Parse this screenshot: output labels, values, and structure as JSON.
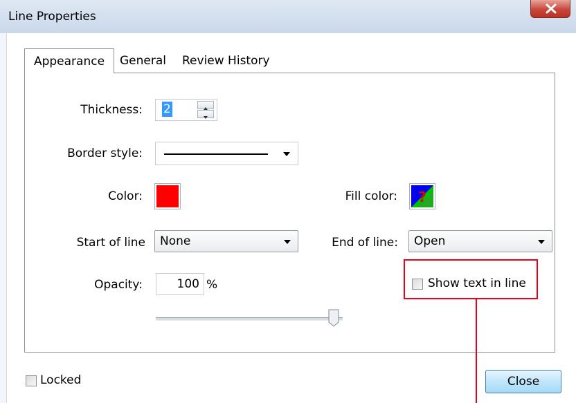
{
  "window": {
    "title": "Line Properties"
  },
  "tabs": [
    {
      "label": "Appearance",
      "active": true
    },
    {
      "label": "General",
      "active": false
    },
    {
      "label": "Review History",
      "active": false
    }
  ],
  "appearance": {
    "thickness": {
      "label": "Thickness:",
      "value": "2"
    },
    "border_style": {
      "label": "Border style:"
    },
    "color": {
      "label": "Color:",
      "value": "#ff0000"
    },
    "fill_color": {
      "label": "Fill color:",
      "value": "none",
      "glyph": "?"
    },
    "start_of_line": {
      "label": "Start of line",
      "value": "None"
    },
    "end_of_line": {
      "label": "End of line:",
      "value": "Open"
    },
    "opacity": {
      "label": "Opacity:",
      "value": "100",
      "unit": "%",
      "slider_fraction": 1.0
    },
    "show_text_in_line": {
      "label": "Show text in line",
      "checked": false
    }
  },
  "footer": {
    "locked": {
      "label": "Locked",
      "checked": false
    },
    "close_button": "Close"
  },
  "colors": {
    "highlight": "#e8001c",
    "accent": "#3399ff"
  }
}
